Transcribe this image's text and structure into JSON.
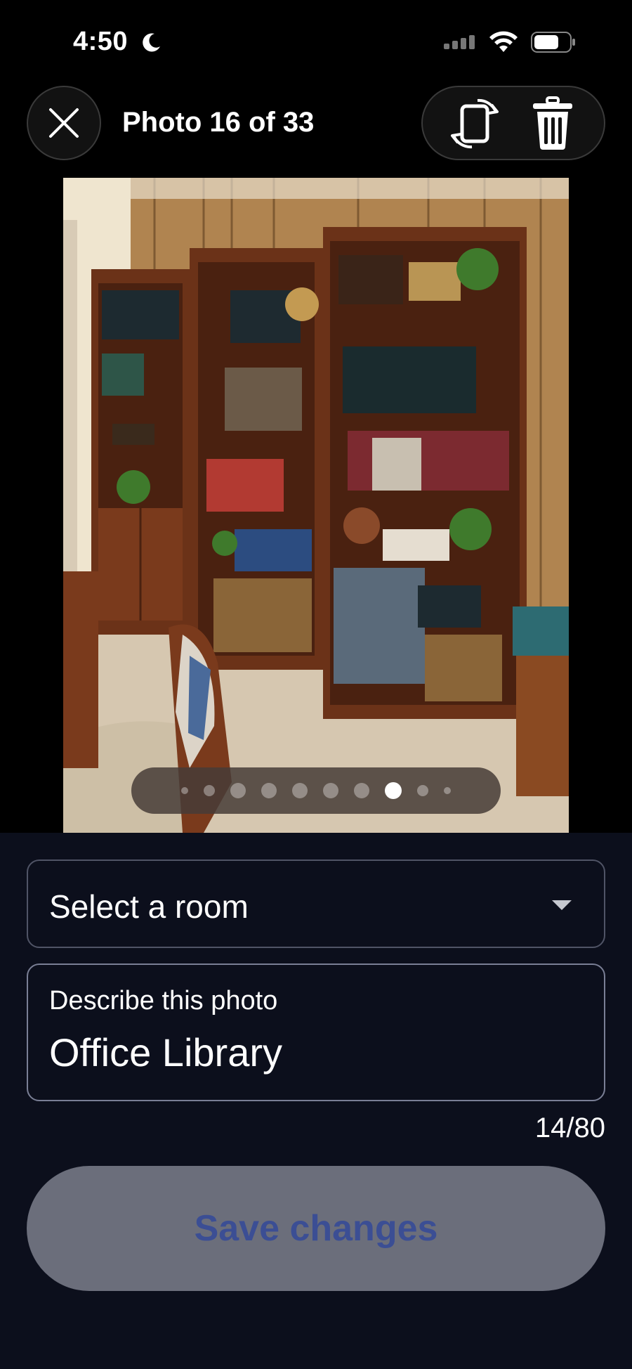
{
  "status_bar": {
    "time": "4:50",
    "moon_icon": "moon-icon",
    "signal_icon": "signal-icon",
    "wifi_icon": "wifi-icon",
    "battery_icon": "battery-icon"
  },
  "header": {
    "close_icon": "close-icon",
    "title": "Photo 16 of 33",
    "actions": [
      {
        "name": "rotate",
        "icon": "rotate-icon"
      },
      {
        "name": "delete",
        "icon": "trash-icon"
      }
    ]
  },
  "photo": {
    "subject": "bookshelves-office",
    "pager": {
      "total_dots": 10,
      "active_index": 7
    }
  },
  "form": {
    "room_select": {
      "placeholder": "Select a room",
      "icon": "caret-down-icon"
    },
    "description": {
      "label": "Describe this photo",
      "value": "Office Library"
    },
    "counter": "14/80",
    "save_label": "Save changes"
  },
  "colors": {
    "panel_bg": "#0c0f1c",
    "save_bg": "#6b6e7b",
    "save_text": "#3b4e94",
    "field_border": "#505466"
  }
}
